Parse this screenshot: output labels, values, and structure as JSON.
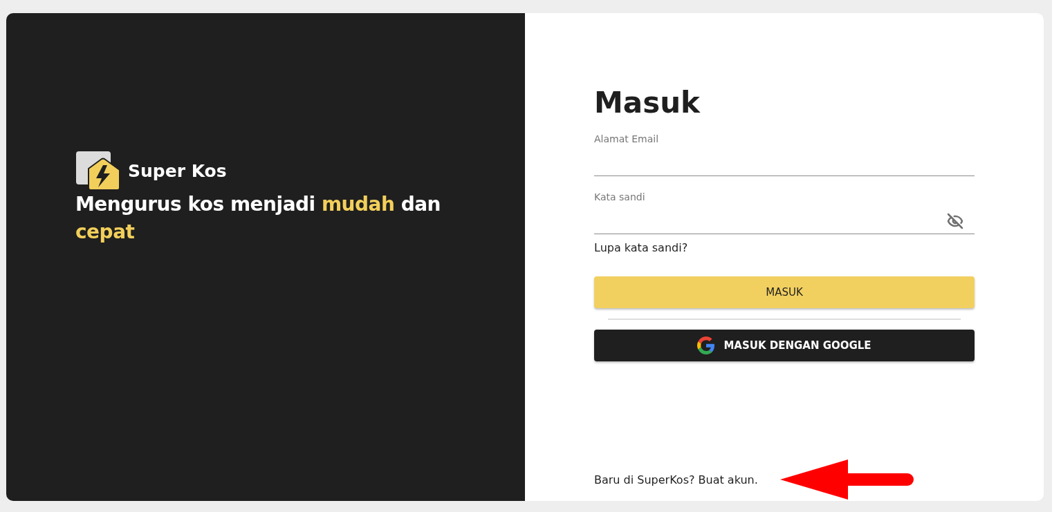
{
  "brand": {
    "name": "Super Kos"
  },
  "tagline": [
    {
      "text": "Mengurus kos menjadi ",
      "highlighted": false
    },
    {
      "text": "mudah",
      "highlighted": true
    },
    {
      "text": " dan ",
      "highlighted": false
    },
    {
      "text": "cepat",
      "highlighted": true
    }
  ],
  "form": {
    "title": "Masuk",
    "fields": [
      {
        "label": "Alamat Email",
        "kind": "email"
      },
      {
        "label": "Kata sandi",
        "kind": "password"
      }
    ],
    "forgot_link": "Lupa kata sandi?",
    "submit_button": "MASUK",
    "google_button": "MASUK DENGAN GOOGLE",
    "signup_text": "Baru di SuperKos? Buat akun."
  },
  "annotation": {
    "kind": "arrow",
    "color": "#ff0000"
  }
}
